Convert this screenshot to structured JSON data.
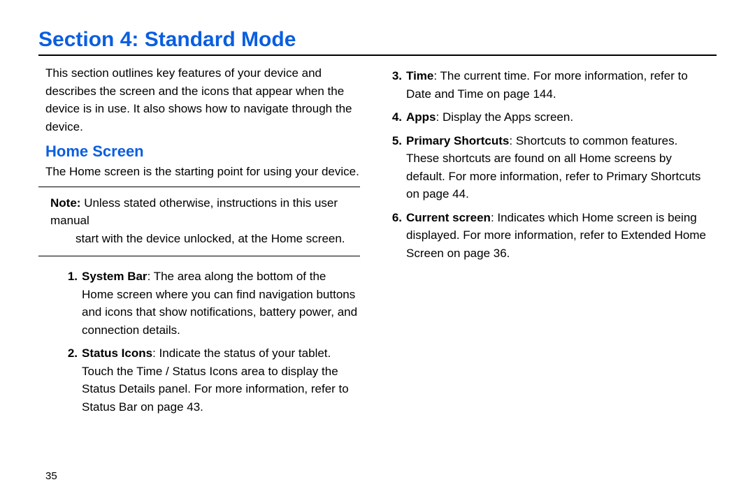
{
  "section_title": "Section 4: Standard Mode",
  "page_number": "35",
  "left": {
    "intro": "This section outlines key features of your device and describes the screen and the icons that appear when the device is in use. It also shows how to navigate through the device.",
    "sub_head": "Home Screen",
    "lead": "The Home screen is the starting point for using your device.",
    "note_label": "Note:",
    "note_body_1": "Unless stated otherwise, instructions in this user manual",
    "note_body_2": "start with the device unlocked, at the Home screen.",
    "items": [
      {
        "num": "1.",
        "term": "System Bar",
        "rest": ": The area along the bottom of the Home screen where you can find navigation buttons and icons that show notifications, battery power, and connection details."
      },
      {
        "num": "2.",
        "term": "Status Icons",
        "rest": ": Indicate the status of your tablet. Touch the Time / Status Icons area to display the Status Details panel. For more information, refer to  Status Bar  on page 43."
      }
    ]
  },
  "right": {
    "items": [
      {
        "num": "3.",
        "term": "Time",
        "rest": ": The current time. For more information, refer to Date and Time on page 144."
      },
      {
        "num": "4.",
        "term": "Apps",
        "rest": ": Display the Apps screen."
      },
      {
        "num": "5.",
        "term": "Primary Shortcuts",
        "rest": ": Shortcuts to common features. These shortcuts are found on all Home screens by default. For more information, refer to  Primary Shortcuts on page 44."
      },
      {
        "num": "6.",
        "term": "Current screen",
        "rest": ": Indicates which Home screen is being displayed. For more information, refer to  Extended Home Screen on page 36."
      }
    ]
  }
}
